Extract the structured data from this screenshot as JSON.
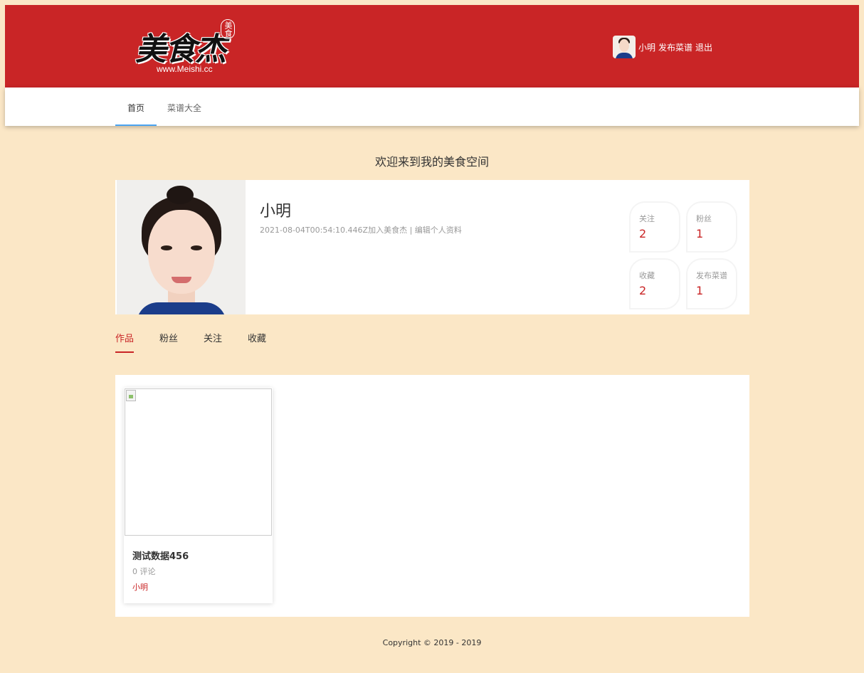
{
  "header": {
    "logo_text": "美食杰",
    "logo_seal": "美食",
    "logo_url": "www.Meishi.cc",
    "user_name": "小明",
    "publish_label": "发布菜谱",
    "logout_label": "退出",
    "brand_color": "#c92526"
  },
  "nav": {
    "items": [
      {
        "label": "首页",
        "active": true
      },
      {
        "label": "菜谱大全",
        "active": false
      }
    ],
    "active_color": "#4aa3f0"
  },
  "welcome": "欢迎来到我的美食空间",
  "profile": {
    "name": "小明",
    "joined": "2021-08-04T00:54:10.446Z加入美食杰",
    "separator": "|",
    "edit_label": "编辑个人资料",
    "stats": [
      {
        "label": "关注",
        "value": "2"
      },
      {
        "label": "粉丝",
        "value": "1"
      },
      {
        "label": "收藏",
        "value": "2"
      },
      {
        "label": "发布菜谱",
        "value": "1"
      }
    ]
  },
  "tabs": [
    {
      "label": "作品",
      "active": true
    },
    {
      "label": "粉丝",
      "active": false
    },
    {
      "label": "关注",
      "active": false
    },
    {
      "label": "收藏",
      "active": false
    }
  ],
  "works": [
    {
      "title": "测试数据456",
      "comments": "0 评论",
      "author": "小明"
    }
  ],
  "footer": "Copyright © 2019 - 2019"
}
